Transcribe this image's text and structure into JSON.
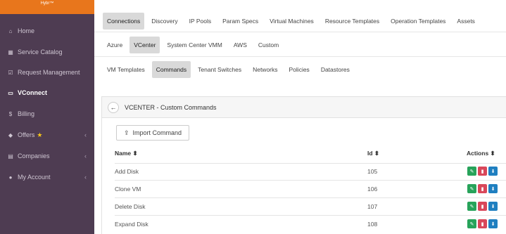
{
  "sidebar": {
    "brand": "Hybr™",
    "items": [
      {
        "label": "Home",
        "icon": "home-icon",
        "glyph": "⌂"
      },
      {
        "label": "Service Catalog",
        "icon": "briefcase-icon",
        "glyph": "▦"
      },
      {
        "label": "Request Management",
        "icon": "checklist-icon",
        "glyph": "☑"
      },
      {
        "label": "VConnect",
        "icon": "monitor-icon",
        "glyph": "▭",
        "active": true
      },
      {
        "label": "Billing",
        "icon": "dollar-icon",
        "glyph": "$"
      },
      {
        "label": "Offers",
        "icon": "tag-icon",
        "glyph": "◆"
      },
      {
        "label": "Companies",
        "icon": "building-icon",
        "glyph": "▤"
      },
      {
        "label": "My Account",
        "icon": "user-icon",
        "glyph": "●"
      }
    ]
  },
  "tabs_row1": [
    "Connections",
    "Discovery",
    "IP Pools",
    "Param Specs",
    "Virtual Machines",
    "Resource Templates",
    "Operation Templates",
    "Assets"
  ],
  "tabs_row2": [
    "Azure",
    "VCenter",
    "System Center VMM",
    "AWS",
    "Custom"
  ],
  "tabs_row3": [
    "VM Templates",
    "Commands",
    "Tenant Switches",
    "Networks",
    "Policies",
    "Datastores"
  ],
  "panel": {
    "title": "VCENTER - Custom Commands",
    "import_label": "Import Command"
  },
  "table": {
    "headers": {
      "name": "Name ⬍",
      "id": "Id ⬍",
      "actions": "Actions ⬍"
    },
    "rows": [
      {
        "name": "Add Disk",
        "id": "105"
      },
      {
        "name": "Clone VM",
        "id": "106"
      },
      {
        "name": "Delete Disk",
        "id": "107"
      },
      {
        "name": "Expand Disk",
        "id": "108"
      }
    ]
  },
  "colors": {
    "sidebar_bg": "#4e3c52",
    "edit": "#27a35a",
    "delete": "#d9475a",
    "download": "#1f7fc0"
  }
}
